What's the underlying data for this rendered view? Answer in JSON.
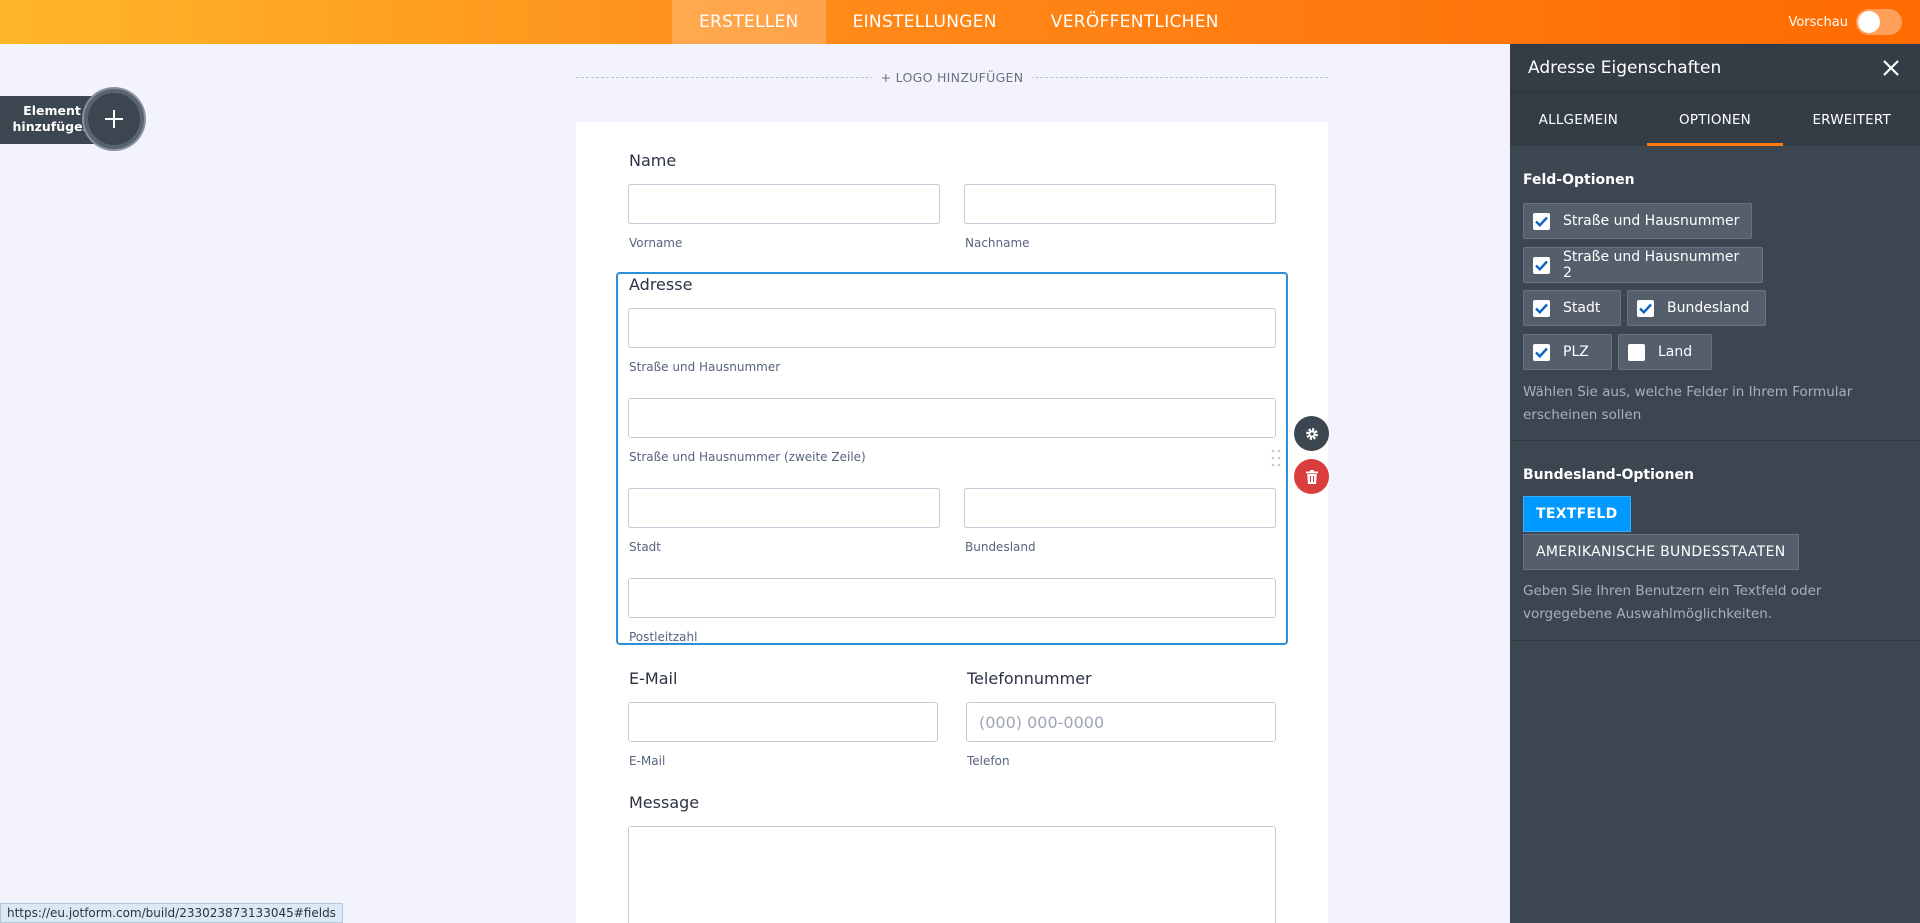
{
  "topbar": {
    "tabs": [
      {
        "label": "ERSTELLEN",
        "active": true
      },
      {
        "label": "EINSTELLUNGEN",
        "active": false
      },
      {
        "label": "VERÖFFENTLICHEN",
        "active": false
      }
    ],
    "preview_label": "Vorschau",
    "preview_on": false
  },
  "add_element": {
    "line1": "Element",
    "line2": "hinzufügen"
  },
  "logo": {
    "label": "+ LOGO HINZUFÜGEN"
  },
  "form": {
    "name": {
      "label": "Name",
      "first_sub": "Vorname",
      "last_sub": "Nachname"
    },
    "address": {
      "label": "Adresse",
      "street_sub": "Straße und Hausnummer",
      "street2_sub": "Straße und Hausnummer (zweite Zeile)",
      "city_sub": "Stadt",
      "state_sub": "Bundesland",
      "zip_sub": "Postleitzahl"
    },
    "email": {
      "label": "E-Mail",
      "sub": "E-Mail"
    },
    "phone": {
      "label": "Telefonnummer",
      "placeholder": "(000) 000-0000",
      "sub": "Telefon"
    },
    "message": {
      "label": "Message"
    }
  },
  "status_url": "https://eu.jotform.com/build/233023873133045#fields",
  "panel": {
    "title": "Adresse Eigenschaften",
    "tabs": [
      {
        "label": "ALLGEMEIN",
        "active": false
      },
      {
        "label": "OPTIONEN",
        "active": true
      },
      {
        "label": "ERWEITERT",
        "active": false
      }
    ],
    "field_options": {
      "title": "Feld-Optionen",
      "items": [
        {
          "label": "Straße und Hausnummer",
          "checked": true
        },
        {
          "label": "Straße und Hausnummer 2",
          "checked": true
        },
        {
          "label": "Stadt",
          "checked": true
        },
        {
          "label": "Bundesland",
          "checked": true
        },
        {
          "label": "PLZ",
          "checked": true
        },
        {
          "label": "Land",
          "checked": false
        }
      ],
      "help": "Wählen Sie aus, welche Felder in Ihrem Formular erscheinen sollen"
    },
    "state_options": {
      "title": "Bundesland-Optionen",
      "option_text": "TEXTFELD",
      "option_us": "AMERIKANISCHE BUNDESSTAATEN",
      "help": "Geben Sie Ihren Benutzern ein Textfeld oder vorgegebene Auswahlmöglichkeiten."
    }
  },
  "colors": {
    "accent": "#ff7a0f",
    "selected": "#2b90d9",
    "primary_button": "#0099ff",
    "delete": "#d93d3d"
  }
}
